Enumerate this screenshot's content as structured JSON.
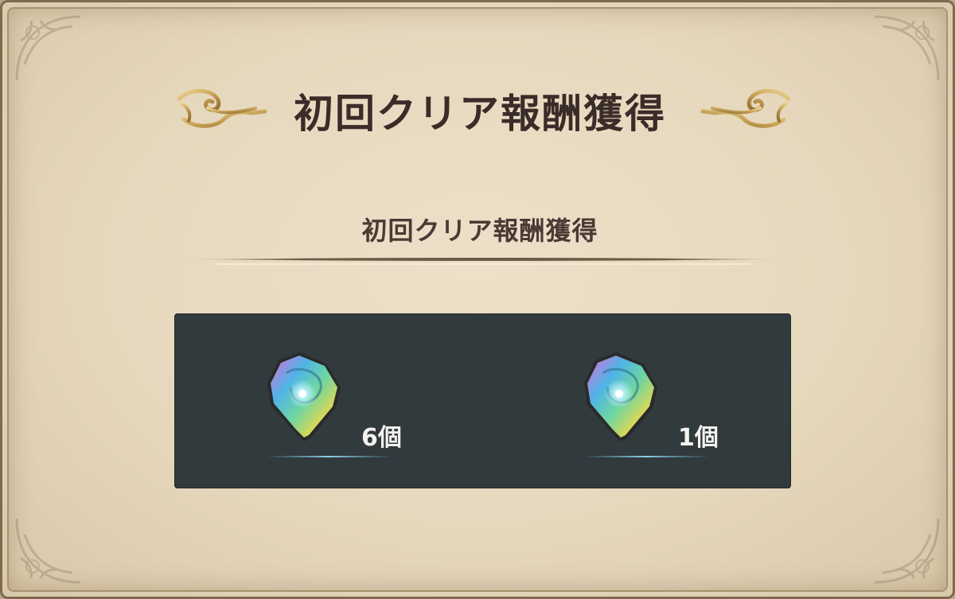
{
  "dialog": {
    "title": "初回クリア報酬獲得",
    "subtitle": "初回クリア報酬獲得"
  },
  "rewards": [
    {
      "icon": "rainbow-crystal-icon",
      "count": "6個"
    },
    {
      "icon": "rainbow-crystal-icon",
      "count": "1個"
    }
  ],
  "colors": {
    "panel_bg": "#e6d8bd",
    "title_text": "#3a2c28",
    "reward_box_bg": "#313a3d",
    "flourish_gold": "#c9a55a"
  }
}
